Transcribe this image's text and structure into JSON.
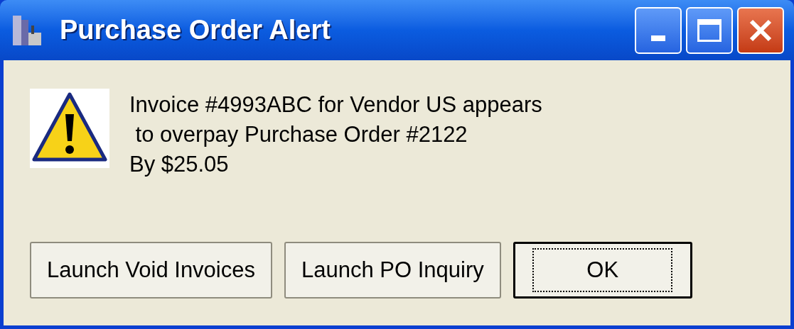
{
  "window": {
    "title": "Purchase Order Alert"
  },
  "message": "Invoice #4993ABC for Vendor US appears\n to overpay Purchase Order #2122\nBy $25.05",
  "buttons": [
    {
      "label": "Launch Void Invoices",
      "default": false
    },
    {
      "label": "Launch PO Inquiry",
      "default": false
    },
    {
      "label": "OK",
      "default": true
    }
  ]
}
